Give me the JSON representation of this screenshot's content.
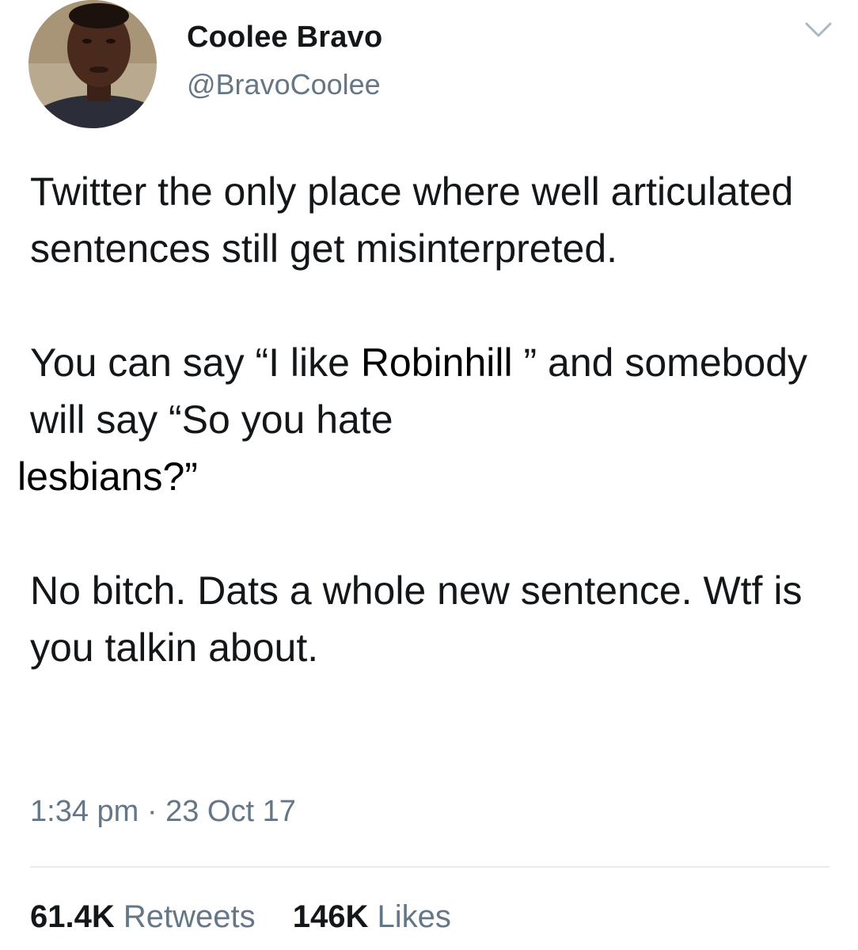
{
  "user": {
    "display_name": "Coolee Bravo",
    "handle": "@BravoCoolee"
  },
  "tweet": {
    "p1": "Twitter the only place where well articulated sentences still get misinterpreted.",
    "p2_start": "You can say “I like ",
    "p2_overlay": "Robinhill ",
    "p2_end": "” and somebody will say “So you hate",
    "p2_overlay2": "lesbians?”",
    "p3": "No bitch. Dats a whole new sentence. Wtf is you talkin about."
  },
  "meta": {
    "timestamp": "1:34 pm · 23 Oct 17"
  },
  "stats": {
    "retweets_count": "61.4K",
    "retweets_label": "Retweets",
    "likes_count": "146K",
    "likes_label": "Likes"
  },
  "icons": {
    "chevron": "chevron-down-icon"
  },
  "colors": {
    "text": "#14171a",
    "secondary": "#657786",
    "divider": "#e6ecf0"
  }
}
